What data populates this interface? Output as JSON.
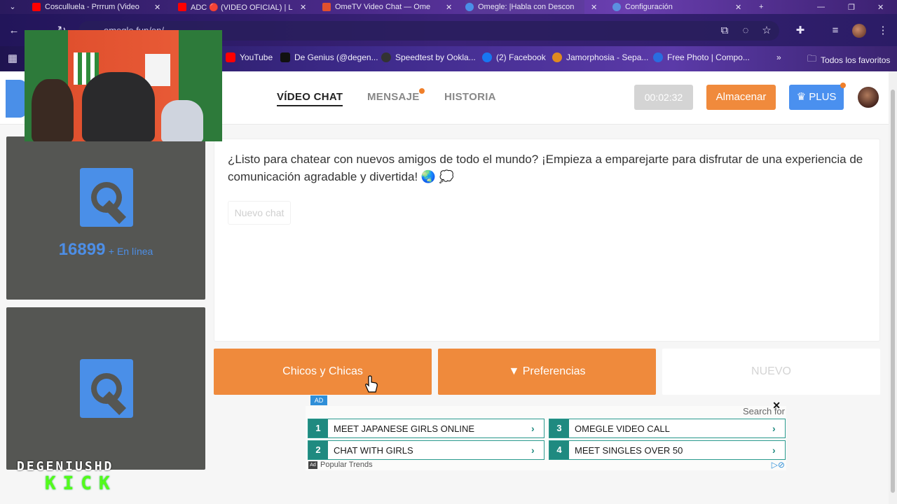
{
  "browser": {
    "tabs": [
      {
        "title": "Cosculluela - Prrrum (Video",
        "favicon_color": "#ff0000"
      },
      {
        "title": "ADC 🔴 (VIDEO OFICIAL) | L",
        "favicon_color": "#ff0000"
      },
      {
        "title": "OmeTV Video Chat — Ome",
        "favicon_color": "#e0502e"
      },
      {
        "title": "Omegle: |Habla con Descon",
        "favicon_color": "#4a8fe8",
        "active": true
      },
      {
        "title": "Configuración",
        "favicon_color": "#5b8fe0"
      }
    ],
    "url": "omegle.fun/en/",
    "bookmarks": [
      {
        "label": "YouTube",
        "icon": "youtube-icon",
        "color": "#ff0000"
      },
      {
        "label": "De Genius (@degen...",
        "icon": "tiktok-icon",
        "color": "#111111"
      },
      {
        "label": "Speedtest by Ookla...",
        "icon": "speedtest-icon",
        "color": "#333333"
      },
      {
        "label": "(2) Facebook",
        "icon": "facebook-icon",
        "color": "#1877f2"
      },
      {
        "label": "Jamorphosia - Sepa...",
        "icon": "jamorphosia-icon",
        "color": "#e08a20"
      },
      {
        "label": "Free Photo | Compo...",
        "icon": "freepik-icon",
        "color": "#2a6de0"
      }
    ],
    "all_bookmarks": "Todos los favoritos"
  },
  "header": {
    "nav": [
      {
        "label": "VÍDEO CHAT",
        "active": true
      },
      {
        "label": "MENSAJE",
        "active": false,
        "notify": true
      },
      {
        "label": "HISTORIA",
        "active": false
      }
    ],
    "timer": "00:02:32",
    "store_label": "Almacenar",
    "plus_label": "PLUS"
  },
  "sidebar": {
    "online_count": "16899",
    "online_label": "+ En línea"
  },
  "chat": {
    "welcome": "¿Listo para chatear con nuevos amigos de todo el mundo? ¡Empieza a emparejarte para disfrutar de una experiencia de comunicación agradable y divertida! 🌏 💭",
    "new_chat_placeholder": "Nuevo chat"
  },
  "actions": {
    "gender_label": "Chicos y Chicas",
    "preferences_label": "Preferencias",
    "new_label": "NUEVO"
  },
  "ad": {
    "badge": "AD",
    "search_label": "Search for",
    "items": [
      {
        "n": "1",
        "text": "MEET JAPANESE GIRLS ONLINE"
      },
      {
        "n": "2",
        "text": "CHAT WITH GIRLS"
      },
      {
        "n": "3",
        "text": "OMEGLE VIDEO CALL"
      },
      {
        "n": "4",
        "text": "MEET SINGLES OVER 50"
      }
    ],
    "footer": "Popular Trends"
  },
  "overlay": {
    "channel": "DEGENIUSHD",
    "platform": "KICK"
  },
  "colors": {
    "accent_orange": "#ef8a3c",
    "accent_blue": "#4a90ef",
    "video_bg": "#555653",
    "ad_teal": "#1f8a80"
  }
}
